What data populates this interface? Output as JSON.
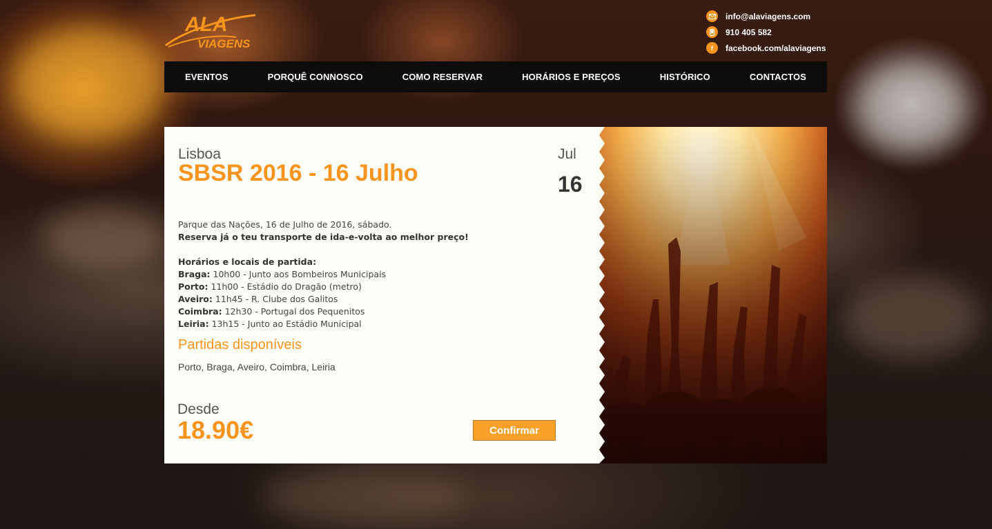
{
  "brand": {
    "logo_top": "ALA",
    "logo_bottom": "VIAGENS",
    "accent": "#f7941d"
  },
  "contacts": [
    {
      "icon": "envelope-icon",
      "text": "info@alaviagens.com"
    },
    {
      "icon": "phone-icon",
      "text": "910 405 582"
    },
    {
      "icon": "facebook-icon",
      "text": "facebook.com/alaviagens"
    }
  ],
  "nav": {
    "items": [
      {
        "label": "EVENTOS"
      },
      {
        "label": "PORQUÊ CONNOSCO"
      },
      {
        "label": "COMO RESERVAR"
      },
      {
        "label": "HORÁRIOS E PREÇOS"
      },
      {
        "label": "HISTÓRICO"
      },
      {
        "label": "CONTACTOS"
      }
    ]
  },
  "event": {
    "city": "Lisboa",
    "title": "SBSR 2016 - 16 Julho",
    "month": "Jul",
    "day": "16",
    "intro": "Parque das Nações, 16 de Julho de 2016, sábado.",
    "cta_text": "Reserva já o teu transporte de ida-e-volta ao melhor preço!",
    "schedule_title": "Horários e locais de partida:",
    "schedule": [
      {
        "city": "Braga:",
        "detail": " 10h00 - Junto aos Bombeiros Municipais"
      },
      {
        "city": "Porto:",
        "detail": " 11h00 - Estádio do Dragão (metro)"
      },
      {
        "city": "Aveiro:",
        "detail": " 11h45 - R. Clube dos Galitos"
      },
      {
        "city": "Coimbra:",
        "detail": " 12h30 - Portugal dos Pequenitos"
      },
      {
        "city": "Leiria:",
        "detail": " 13h15 - Junto ao Estádio Municipal"
      }
    ],
    "departures_title": "Partidas disponíveis",
    "departures_list": "Porto, Braga, Aveiro, Coimbra, Leiria",
    "price_label": "Desde",
    "price": "18.90€",
    "confirm_label": "Confirmar"
  }
}
